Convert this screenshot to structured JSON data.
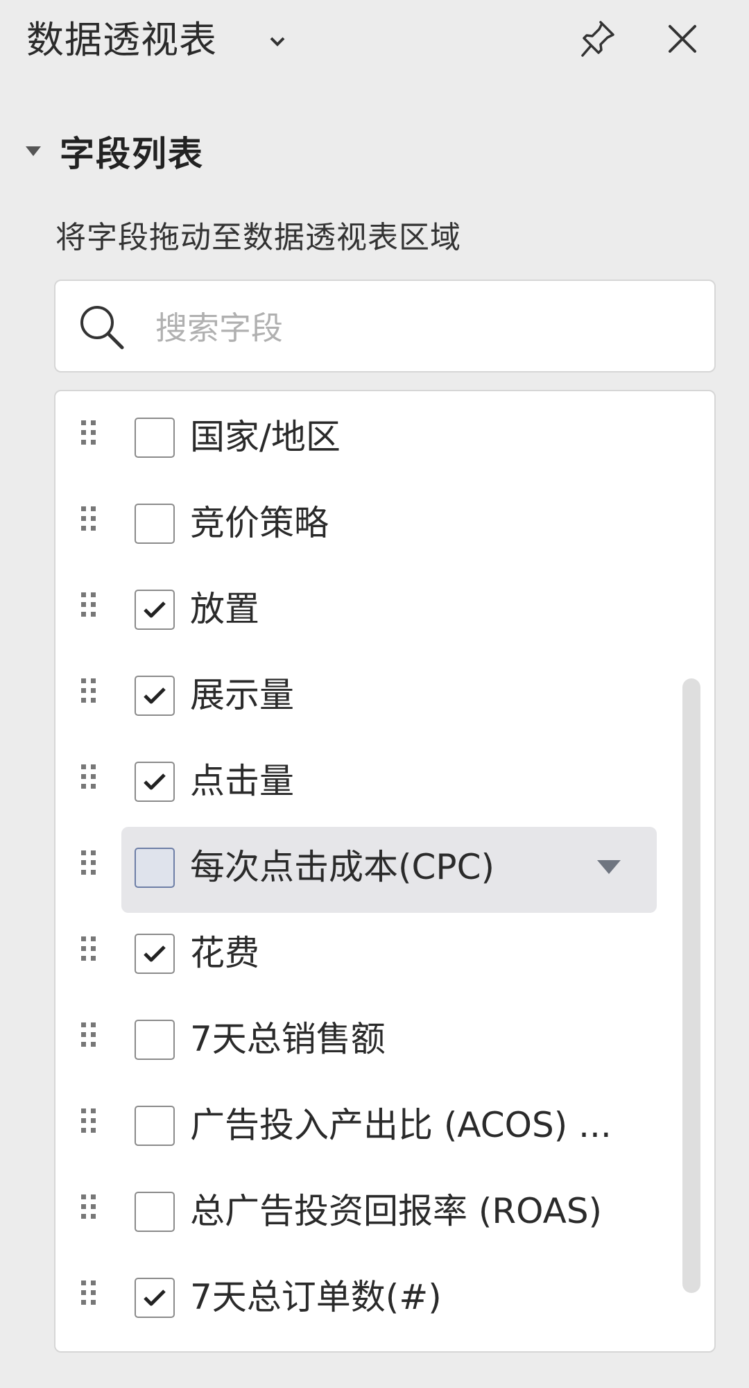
{
  "header": {
    "title": "数据透视表"
  },
  "section": {
    "title": "字段列表",
    "hint": "将字段拖动至数据透视表区域"
  },
  "search": {
    "placeholder": "搜索字段",
    "value": ""
  },
  "fields": [
    {
      "label": "国家/地区",
      "checked": false
    },
    {
      "label": "竞价策略",
      "checked": false
    },
    {
      "label": "放置",
      "checked": true
    },
    {
      "label": "展示量",
      "checked": true
    },
    {
      "label": "点击量",
      "checked": true
    },
    {
      "label": "每次点击成本(CPC)",
      "checked": false,
      "hovered": true
    },
    {
      "label": "花费",
      "checked": true
    },
    {
      "label": "7天总销售额",
      "checked": false
    },
    {
      "label": "广告投入产出比 (ACOS) ...",
      "checked": false
    },
    {
      "label": "总广告投资回报率 (ROAS)",
      "checked": false
    },
    {
      "label": "7天总订单数(#)",
      "checked": true
    }
  ],
  "icons": {
    "title_dropdown": "chevron-down-icon",
    "pin": "pin-icon",
    "close": "close-icon",
    "collapse": "triangle-down-icon",
    "search": "search-icon",
    "drag": "drag-handle-icon",
    "check": "checkmark-icon"
  },
  "colors": {
    "panel_bg": "#ececec",
    "list_bg": "#ffffff",
    "hover_bg": "#e6e6e9",
    "checkbox_border": "#8a8a8a",
    "text": "#2a2a2a",
    "placeholder": "#b0b0b0"
  }
}
